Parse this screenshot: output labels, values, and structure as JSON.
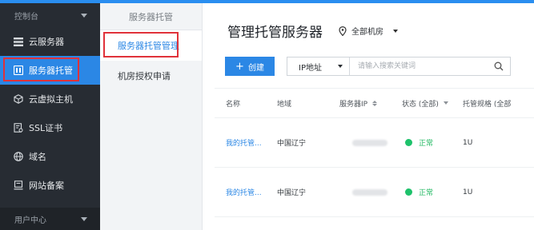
{
  "left_nav": {
    "header": "控制台",
    "items": [
      {
        "label": "云服务器",
        "icon": "server-list-icon"
      },
      {
        "label": "服务器托管",
        "icon": "server-hosting-icon",
        "active": true
      },
      {
        "label": "云虚拟主机",
        "icon": "cube-icon"
      },
      {
        "label": "SSL证书",
        "icon": "certificate-icon"
      },
      {
        "label": "域名",
        "icon": "globe-icon"
      },
      {
        "label": "网站备案",
        "icon": "record-icon"
      }
    ],
    "footer": "用户中心"
  },
  "sub_nav": {
    "title": "服务器托管",
    "items": [
      {
        "label": "服务器托管管理",
        "active": true
      },
      {
        "label": "机房授权申请"
      }
    ]
  },
  "main": {
    "title": "管理托管服务器",
    "region_selector": "全部机房",
    "create_button": "创建",
    "filter_field": "IP地址",
    "search_placeholder": "请输入搜索关键词",
    "table": {
      "headers": [
        "名称",
        "地域",
        "服务器IP",
        "状态 (全部)",
        "托管规格 (全部"
      ],
      "rows": [
        {
          "name": "我的托管...",
          "region": "中国辽宁",
          "status": "正常",
          "spec": "1U"
        },
        {
          "name": "我的托管...",
          "region": "中国辽宁",
          "status": "正常",
          "spec": "1U"
        }
      ]
    }
  },
  "colors": {
    "accent": "#2b87e5",
    "nav_bg": "#272c33",
    "status_ok": "#1ec26b",
    "highlight_box": "#e0323a"
  }
}
